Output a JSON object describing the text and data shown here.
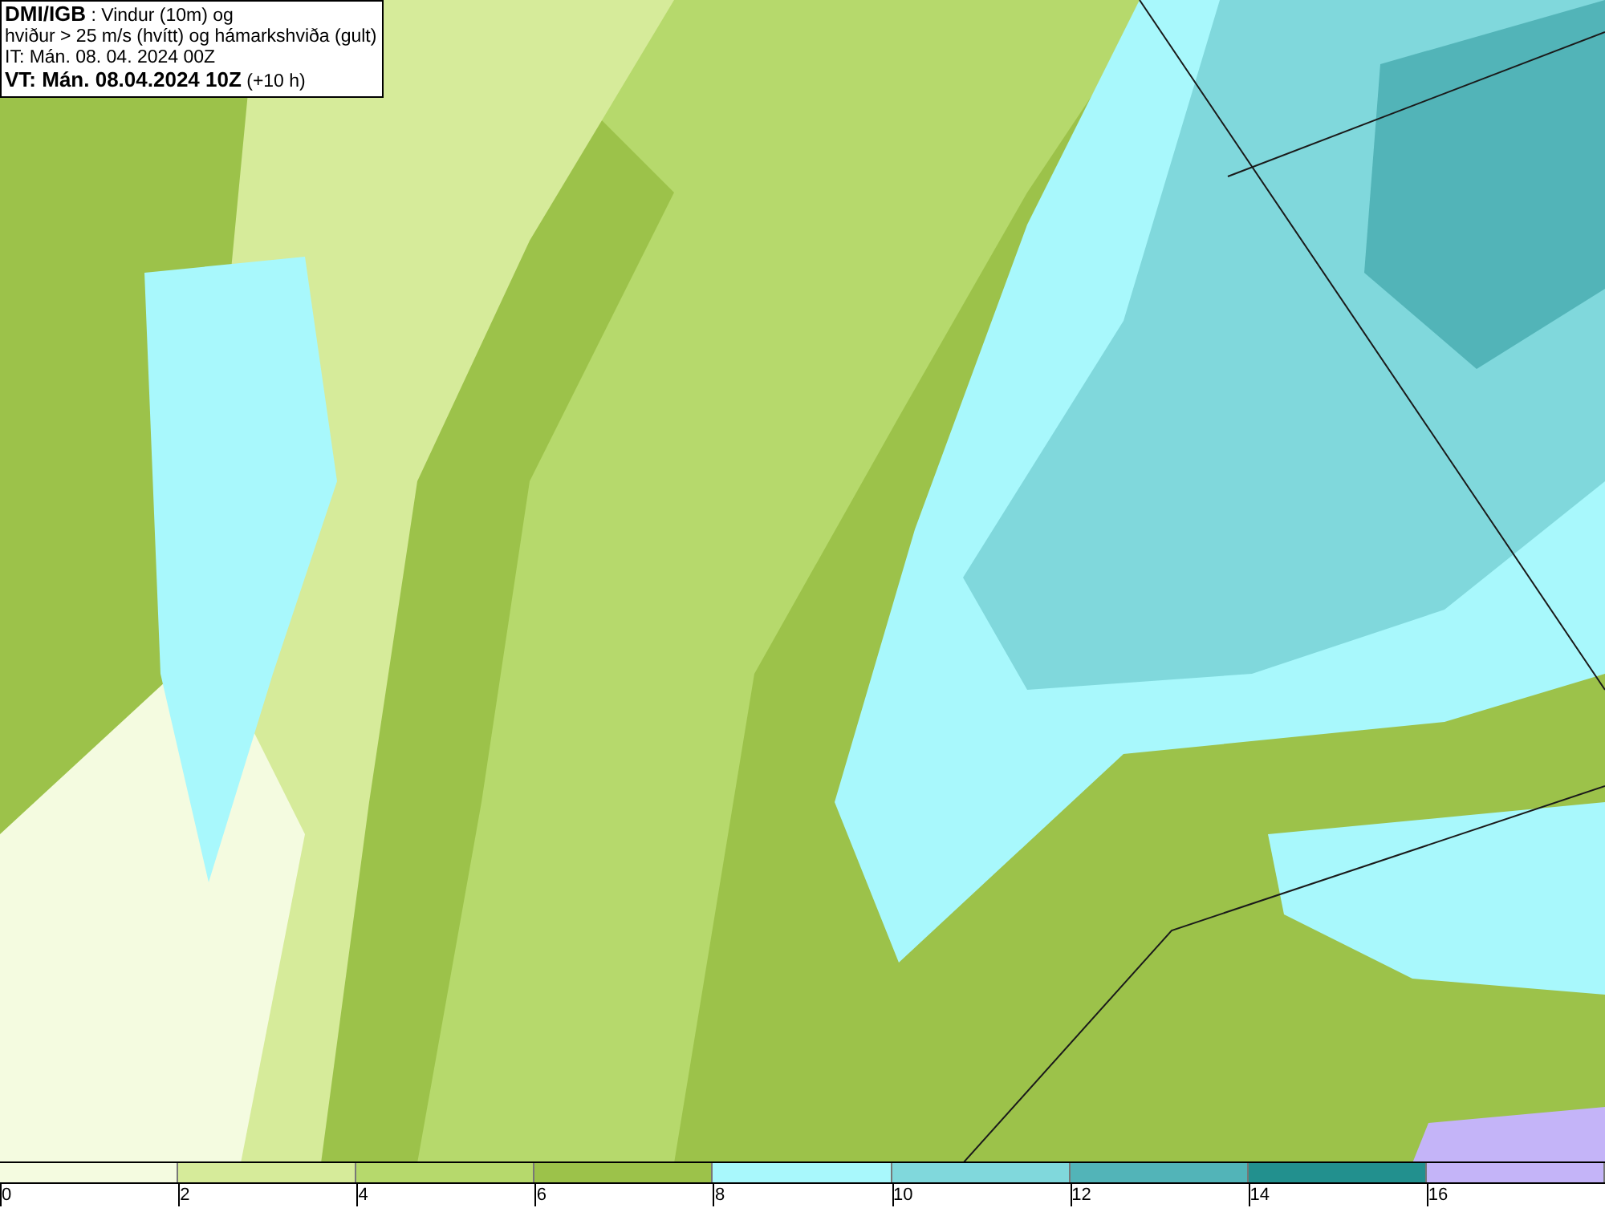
{
  "header": {
    "lines": [
      "**DMI/IGB** : Vindur (10m) og",
      "hviður > 25 m/s (hvítt) og hámarkshviða (gult)",
      "IT: Mán. 08. 04. 2024 00Z",
      "**VT: Mán. 08.04.2024 10Z** (+10 h)"
    ]
  },
  "legend": {
    "bins": [
      {
        "color": "#f4fbe0"
      },
      {
        "color": "#d6eb9a"
      },
      {
        "color": "#b6d96c"
      },
      {
        "color": "#9cc24a"
      },
      {
        "color": "#a8f8fc"
      },
      {
        "color": "#80d8dc"
      },
      {
        "color": "#52b4b8"
      },
      {
        "color": "#22908e"
      },
      {
        "color": "#c4b4f8"
      }
    ],
    "ticks": [
      "0",
      "2",
      "4",
      "6",
      "8",
      "10",
      "12",
      "14",
      "16"
    ]
  }
}
